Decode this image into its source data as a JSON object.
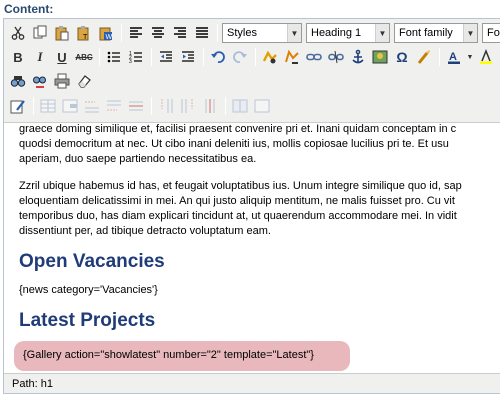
{
  "field_label": "Content:",
  "toolbar": {
    "styles_select": "Styles",
    "format_select": "Heading 1",
    "font_family_select": "Font family",
    "font_size_select_partial": "Fo"
  },
  "content": {
    "para1_lines": [
      "graece doming similique et, facilisi praesent convenire pri et. Inani quidam conceptam in c",
      "quodsi democritum at nec. Ut cibo inani deleniti ius, mollis copiosae lucilius pri te. Et usu",
      "aperiam, duo saepe partiendo necessitatibus ea."
    ],
    "para2_lines": [
      "Zzril ubique habemus id has, et feugait voluptatibus ius. Unum integre similique quo id, sap",
      "eloquentiam delicatissimi in mei. An qui justo aliquip mentitum, ne malis fuisset pro. Cu vit",
      "temporibus duo, has diam explicari tincidunt at, ut quaerendum accommodare mei. In vidit",
      "dissentiunt per, ad tibique detracto voluptatum eam."
    ],
    "heading1": "Open Vacancies",
    "news_tag": "{news category='Vacancies'}",
    "heading2": "Latest Projects",
    "gallery_tag": "{Gallery action=\"showlatest\" number=\"2\" template=\"Latest\"}"
  },
  "status": {
    "path": "Path: h1"
  },
  "colors": {
    "heading": "#1f3c78",
    "highlight": "#e8b8bc",
    "label": "#2a4a70"
  }
}
